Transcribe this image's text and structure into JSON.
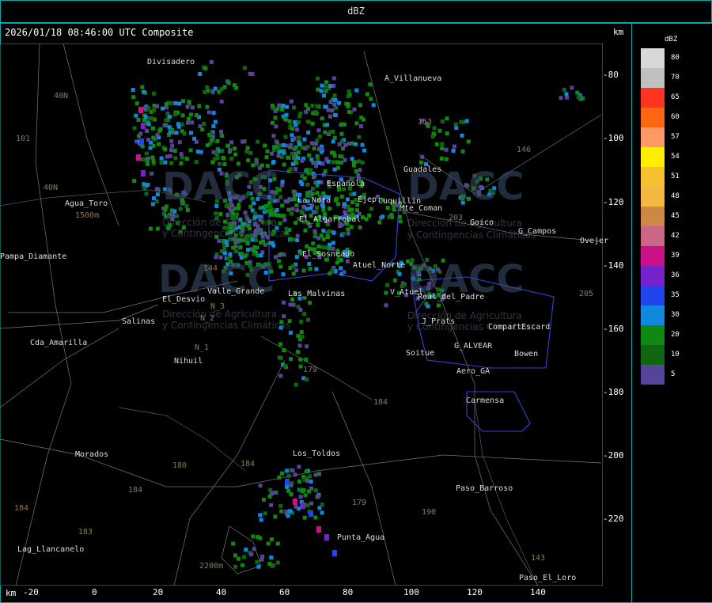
{
  "title": "dBZ",
  "timestamp": "2026/01/18 08:46:00 UTC Composite",
  "unit_label": "km",
  "legend": {
    "title": "dBZ",
    "items": [
      {
        "label": "80",
        "color": "#d8d8d8"
      },
      {
        "label": "70",
        "color": "#c0c0c0"
      },
      {
        "label": "65",
        "color": "#ff3322"
      },
      {
        "label": "60",
        "color": "#ff6611"
      },
      {
        "label": "57",
        "color": "#ff9966"
      },
      {
        "label": "54",
        "color": "#ffee00"
      },
      {
        "label": "51",
        "color": "#f6c030"
      },
      {
        "label": "48",
        "color": "#f4b840"
      },
      {
        "label": "45",
        "color": "#cc8844"
      },
      {
        "label": "42",
        "color": "#cc6688"
      },
      {
        "label": "39",
        "color": "#cc1188"
      },
      {
        "label": "36",
        "color": "#7722cc"
      },
      {
        "label": "35",
        "color": "#2244ee"
      },
      {
        "label": "30",
        "color": "#1188dd"
      },
      {
        "label": "20",
        "color": "#118811"
      },
      {
        "label": "10",
        "color": "#116611"
      },
      {
        "label": "5",
        "color": "#554499"
      }
    ]
  },
  "y_ticks": [
    "-80",
    "-100",
    "-120",
    "-140",
    "-160",
    "-180",
    "-200",
    "-220"
  ],
  "x_ticks": [
    "-20",
    "0",
    "20",
    "40",
    "60",
    "80",
    "100",
    "120",
    "140"
  ],
  "places": [
    {
      "name": "Divisadero",
      "x": 186,
      "y": 73
    },
    {
      "name": "A_Villanueva",
      "x": 486,
      "y": 94
    },
    {
      "name": "Guadales",
      "x": 510,
      "y": 209
    },
    {
      "name": "Agua_Toro",
      "x": 82,
      "y": 252
    },
    {
      "name": "La_Nora",
      "x": 376,
      "y": 248
    },
    {
      "name": "Española",
      "x": 413,
      "y": 227
    },
    {
      "name": "Ejep",
      "x": 452,
      "y": 247
    },
    {
      "name": "Cuquillin",
      "x": 478,
      "y": 249
    },
    {
      "name": "Mte_Coman",
      "x": 505,
      "y": 258
    },
    {
      "name": "Goico",
      "x": 594,
      "y": 276
    },
    {
      "name": "G_Campos",
      "x": 655,
      "y": 287
    },
    {
      "name": "Ovejer",
      "x": 733,
      "y": 299
    },
    {
      "name": "Pampa_Diamante",
      "x": 0,
      "y": 319
    },
    {
      "name": "El_Algarrobal",
      "x": 378,
      "y": 272
    },
    {
      "name": "El_Sosneado",
      "x": 382,
      "y": 316
    },
    {
      "name": "Atuel_Norte",
      "x": 446,
      "y": 330
    },
    {
      "name": "El_Desvio",
      "x": 205,
      "y": 373
    },
    {
      "name": "Valle_Grande",
      "x": 262,
      "y": 363
    },
    {
      "name": "Las_Malvinas",
      "x": 364,
      "y": 366
    },
    {
      "name": "V_Atuel",
      "x": 493,
      "y": 364
    },
    {
      "name": "Real_del_Padre",
      "x": 528,
      "y": 370
    },
    {
      "name": "Salinas",
      "x": 154,
      "y": 401
    },
    {
      "name": "J_Prats",
      "x": 533,
      "y": 401
    },
    {
      "name": "CompartEscard",
      "x": 617,
      "y": 408
    },
    {
      "name": "Cda_Amarilla",
      "x": 38,
      "y": 428
    },
    {
      "name": "G_ALVEAR",
      "x": 574,
      "y": 432
    },
    {
      "name": "Bowen",
      "x": 650,
      "y": 442
    },
    {
      "name": "Soitue",
      "x": 513,
      "y": 441
    },
    {
      "name": "Nihuil",
      "x": 220,
      "y": 451
    },
    {
      "name": "Aero_GA",
      "x": 577,
      "y": 464
    },
    {
      "name": "Carmensa",
      "x": 589,
      "y": 501
    },
    {
      "name": "Morados",
      "x": 95,
      "y": 569
    },
    {
      "name": "Los_Toldos",
      "x": 370,
      "y": 568
    },
    {
      "name": "Paso_Barroso",
      "x": 576,
      "y": 612
    },
    {
      "name": "Lag_Llancanelo",
      "x": 22,
      "y": 689
    },
    {
      "name": "Punta_Agua",
      "x": 426,
      "y": 674
    },
    {
      "name": "Paso_El_Loro",
      "x": 656,
      "y": 725
    }
  ],
  "roads": [
    {
      "name": "40N",
      "x": 68,
      "y": 116
    },
    {
      "name": "101",
      "x": 20,
      "y": 170
    },
    {
      "name": "40N",
      "x": 55,
      "y": 232
    },
    {
      "name": "153",
      "x": 528,
      "y": 149
    },
    {
      "name": "146",
      "x": 653,
      "y": 184
    },
    {
      "name": "203",
      "x": 567,
      "y": 270
    },
    {
      "name": "205",
      "x": 732,
      "y": 366
    },
    {
      "name": "144",
      "x": 257,
      "y": 334
    },
    {
      "name": "179",
      "x": 383,
      "y": 462
    },
    {
      "name": "184",
      "x": 472,
      "y": 503
    },
    {
      "name": "180",
      "x": 218,
      "y": 583
    },
    {
      "name": "184",
      "x": 162,
      "y": 614
    },
    {
      "name": "184",
      "x": 304,
      "y": 581
    },
    {
      "name": "184",
      "x": 18,
      "y": 637
    },
    {
      "name": "179",
      "x": 445,
      "y": 630
    },
    {
      "name": "190",
      "x": 533,
      "y": 642
    },
    {
      "name": "183",
      "x": 99,
      "y": 667
    },
    {
      "name": "143",
      "x": 671,
      "y": 700
    },
    {
      "name": "2200m",
      "x": 252,
      "y": 710
    },
    {
      "name": "1500m",
      "x": 95,
      "y": 267
    },
    {
      "name": "N_2",
      "x": 253,
      "y": 397
    },
    {
      "name": "N_1",
      "x": 246,
      "y": 434
    },
    {
      "name": "N_3",
      "x": 266,
      "y": 382
    }
  ],
  "watermark": {
    "brand": "DACC",
    "line1": "Dirección de Agricultura",
    "line2": "y Contingencias Climáticas"
  }
}
